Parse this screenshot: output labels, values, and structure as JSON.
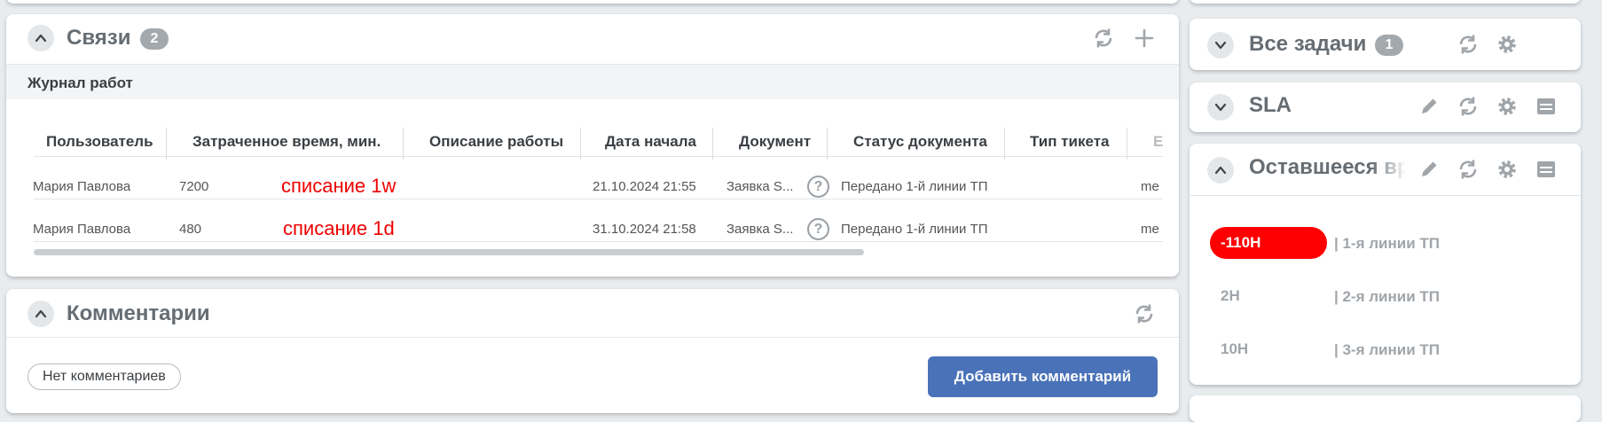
{
  "links_card": {
    "title": "Связи",
    "count": "2",
    "section_title": "Журнал работ",
    "columns": [
      "Пользователь",
      "Затраченное время, мин.",
      "Описание работы",
      "Дата начала",
      "Документ",
      "Статус документа",
      "Тип тикета",
      "Е"
    ],
    "rows": [
      {
        "user": "Мария Павлова",
        "time": "7200",
        "description": "списание 1w",
        "start_date": "21.10.2024 21:55",
        "document": "Заявка S...",
        "status": "Передано 1-й линии ТП",
        "ticket_type": "",
        "extra": "me"
      },
      {
        "user": "Мария Павлова",
        "time": "480",
        "description": "списание 1d",
        "start_date": "31.10.2024 21:58",
        "document": "Заявка S...",
        "status": "Передано 1-й линии ТП",
        "ticket_type": "",
        "extra": "me"
      }
    ]
  },
  "comments_card": {
    "title": "Комментарии",
    "no_comments_label": "Нет комментариев",
    "add_comment_label": "Добавить комментарий"
  },
  "tasks_card": {
    "title": "Все задачи",
    "count": "1"
  },
  "sla_card": {
    "title": "SLA"
  },
  "remaining_card": {
    "title": "Оставшееся вр",
    "timers": [
      {
        "value": "-110H",
        "label": "| 1-я линии ТП",
        "overdue": true
      },
      {
        "value": "2H",
        "label": "| 2-я линии ТП",
        "overdue": false
      },
      {
        "value": "10H",
        "label": "| 3-я линии ТП",
        "overdue": false
      }
    ]
  },
  "colors": {
    "accent_button": "#4a72b8",
    "overdue": "#ff0000",
    "badge": "#a4a9ad",
    "title": "#666d73"
  }
}
